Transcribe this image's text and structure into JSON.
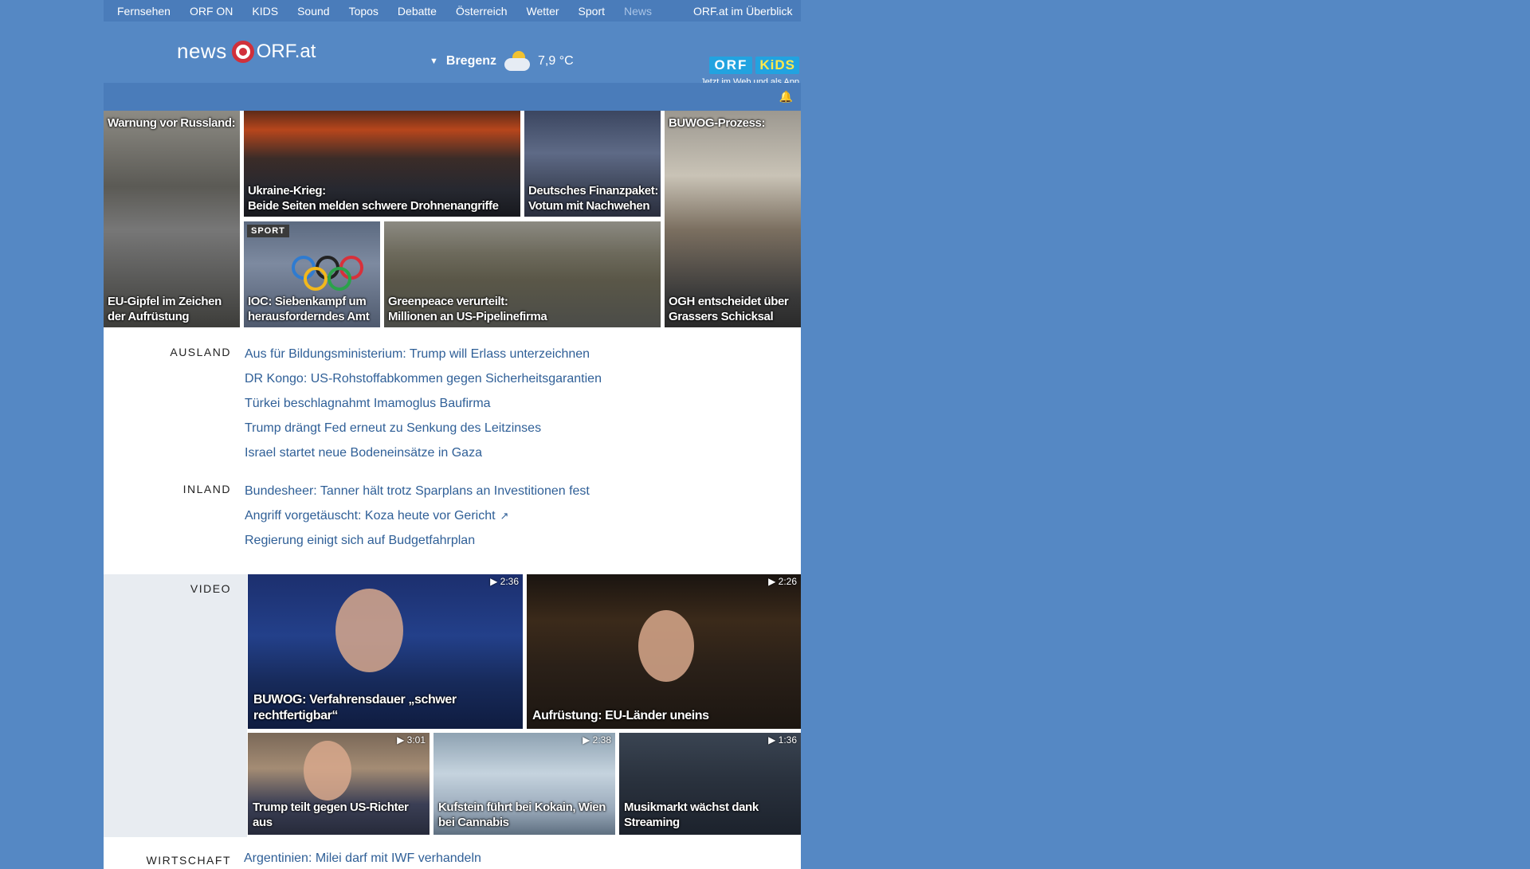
{
  "topnav": {
    "items": [
      "Fernsehen",
      "ORF ON",
      "KIDS",
      "Sound",
      "Topos",
      "Debatte",
      "Österreich",
      "Wetter",
      "Sport",
      "News"
    ],
    "overview": "ORF.at im Überblick"
  },
  "header": {
    "logo_news": "news",
    "logo_orfat": "ORF.at",
    "weather": {
      "city": "Bregenz",
      "temp": "7,9 °C"
    },
    "kids": {
      "orf": "ORF",
      "kids": "KiDS",
      "subtitle": "Jetzt im Web und als App"
    }
  },
  "teasers": {
    "russland_top": "Warnung vor Russland:",
    "russland_bottom": "EU-Gipfel im Zeichen der Aufrüstung",
    "ukraine_line1": "Ukraine-Krieg:",
    "ukraine_line2": "Beide Seiten melden schwere Drohnenangriffe",
    "finanz_line1": "Deutsches Finanzpaket:",
    "finanz_line2": "Votum mit Nachwehen",
    "buwog_top": "BUWOG-Prozess:",
    "buwog_bottom": "OGH entscheidet über Grassers Schicksal",
    "ioc_tag": "SPORT",
    "ioc_caption": "IOC: Siebenkampf um herausforderndes Amt",
    "greenpeace_line1": "Greenpeace verurteilt:",
    "greenpeace_line2": "Millionen an US-Pipelinefirma"
  },
  "ausland": {
    "label": "AUSLAND",
    "items": [
      "Aus für Bildungsministerium: Trump will Erlass unterzeichnen",
      "DR Kongo: US-Rohstoffabkommen gegen Sicherheitsgarantien",
      "Türkei beschlagnahmt Imamoglus Baufirma",
      "Trump drängt Fed erneut zu Senkung des Leitzinses",
      "Israel startet neue Bodeneinsätze in Gaza"
    ]
  },
  "inland": {
    "label": "INLAND",
    "items": [
      "Bundesheer: Tanner hält trotz Sparplans an Investitionen fest",
      "Angriff vorgetäuscht: Koza heute vor Gericht",
      "Regierung einigt sich auf Budgetfahrplan"
    ]
  },
  "video": {
    "label": "VIDEO",
    "items": [
      {
        "duration": "2:36",
        "caption": "BUWOG: Verfahrensdauer „schwer rechtfertigbar“"
      },
      {
        "duration": "2:26",
        "caption": "Aufrüstung: EU-Länder uneins"
      },
      {
        "duration": "3:01",
        "caption": "Trump teilt gegen US-Richter aus"
      },
      {
        "duration": "2:38",
        "caption": "Kufstein führt bei Kokain, Wien bei Cannabis"
      },
      {
        "duration": "1:36",
        "caption": "Musikmarkt wächst dank Streaming"
      }
    ]
  },
  "wirtschaft": {
    "label": "WIRTSCHAFT",
    "first": "Argentinien: Milei darf mit IWF verhandeln"
  }
}
